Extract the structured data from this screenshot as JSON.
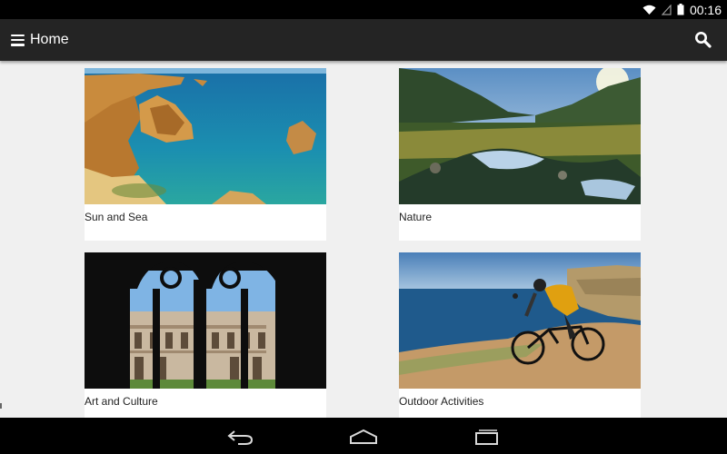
{
  "status_bar": {
    "time": "00:16",
    "icons": [
      "wifi-icon",
      "signal-icon",
      "battery-icon"
    ]
  },
  "action_bar": {
    "title": "Home",
    "menu_icon": "hamburger-menu-icon",
    "search_icon": "search-icon"
  },
  "categories": [
    {
      "label": "Sun and Sea"
    },
    {
      "label": "Nature"
    },
    {
      "label": "Art and Culture"
    },
    {
      "label": "Outdoor Activities"
    }
  ],
  "nav_bar": {
    "icons": [
      "back-icon",
      "home-icon",
      "recent-apps-icon"
    ]
  },
  "colors": {
    "status_bar": "#000000",
    "action_bar": "#242424",
    "background": "#f0f0f0",
    "card": "#ffffff"
  }
}
